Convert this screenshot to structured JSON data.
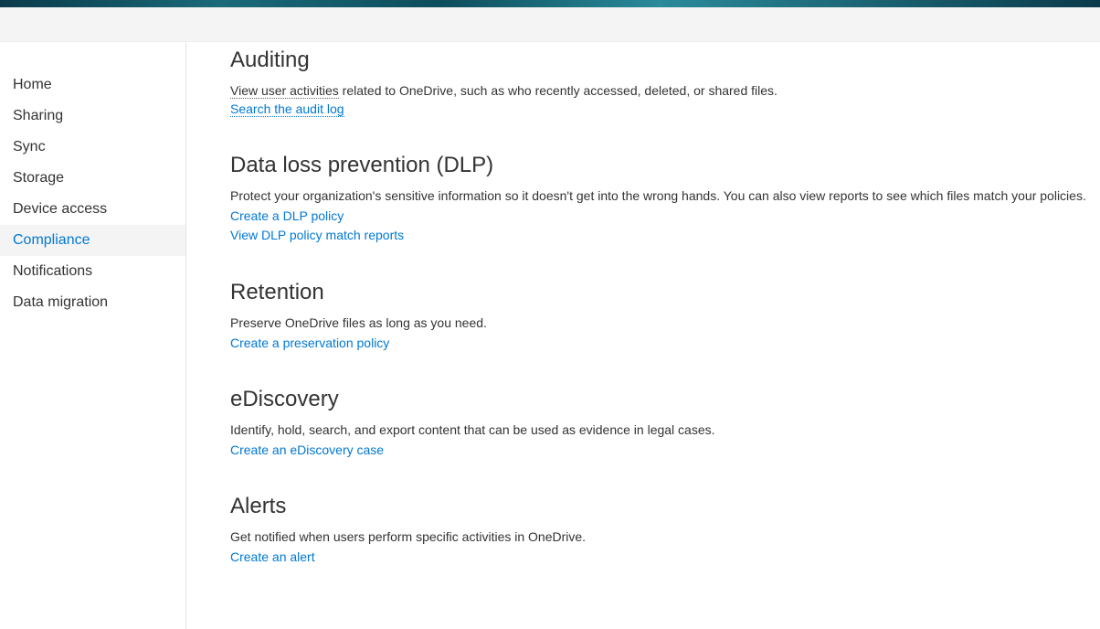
{
  "sidebar": {
    "items": [
      {
        "label": "Home",
        "active": false
      },
      {
        "label": "Sharing",
        "active": false
      },
      {
        "label": "Sync",
        "active": false
      },
      {
        "label": "Storage",
        "active": false
      },
      {
        "label": "Device access",
        "active": false
      },
      {
        "label": "Compliance",
        "active": true
      },
      {
        "label": "Notifications",
        "active": false
      },
      {
        "label": "Data migration",
        "active": false
      }
    ]
  },
  "sections": {
    "auditing": {
      "title": "Auditing",
      "desc_prefix": "View user activities",
      "desc_rest": " related to OneDrive, such as who recently accessed, deleted, or shared files.",
      "link1": "Search the audit log"
    },
    "dlp": {
      "title": "Data loss prevention (DLP)",
      "desc": "Protect your organization's sensitive information so it doesn't get into the wrong hands. You can also view reports to see which files match your policies.",
      "link1": "Create a DLP policy",
      "link2": "View DLP policy match reports"
    },
    "retention": {
      "title": "Retention",
      "desc": "Preserve OneDrive files as long as you need.",
      "link1": "Create a preservation policy"
    },
    "ediscovery": {
      "title": "eDiscovery",
      "desc": "Identify, hold, search, and export content that can be used as evidence in legal cases.",
      "link1": "Create an eDiscovery case"
    },
    "alerts": {
      "title": "Alerts",
      "desc": "Get notified when users perform specific activities in OneDrive.",
      "link1": "Create an alert"
    }
  }
}
